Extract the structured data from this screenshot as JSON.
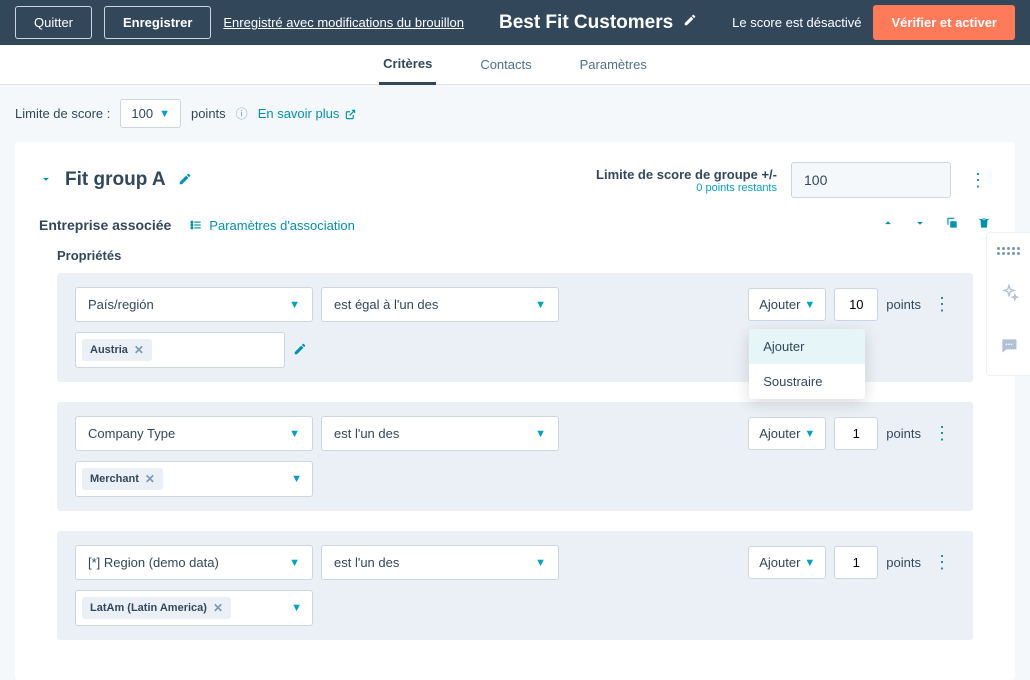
{
  "topbar": {
    "quit": "Quitter",
    "save": "Enregistrer",
    "draft_status": "Enregistré avec modifications du brouillon",
    "title": "Best Fit Customers",
    "score_status": "Le score est désactivé",
    "verify": "Vérifier et activer"
  },
  "tabs": {
    "criteria": "Critères",
    "contacts": "Contacts",
    "params": "Paramètres"
  },
  "score_limit": {
    "label": "Limite de score :",
    "value": "100",
    "points": "points",
    "learn_more": "En savoir plus"
  },
  "group": {
    "name": "Fit group A",
    "limit_label": "Limite de score de groupe +/-",
    "remaining": "0 points restants",
    "limit_value": "100"
  },
  "assoc": {
    "label": "Entreprise associée",
    "params": "Paramètres d'association"
  },
  "props_label": "Propriétés",
  "rules": [
    {
      "property": "País/región",
      "operator": "est égal à l'un des",
      "action": "Ajouter",
      "points": "10",
      "points_label": "points",
      "tag": "Austria",
      "show_pencil": true,
      "tag_wide": false
    },
    {
      "property": "Company Type",
      "operator": "est l'un des",
      "action": "Ajouter",
      "points": "1",
      "points_label": "points",
      "tag": "Merchant",
      "show_pencil": false,
      "tag_wide": true
    },
    {
      "property": "[*] Region (demo data)",
      "operator": "est l'un des",
      "action": "Ajouter",
      "points": "1",
      "points_label": "points",
      "tag": "LatAm (Latin America)",
      "show_pencil": false,
      "tag_wide": true
    }
  ],
  "dropdown": {
    "add": "Ajouter",
    "subtract": "Soustraire"
  }
}
